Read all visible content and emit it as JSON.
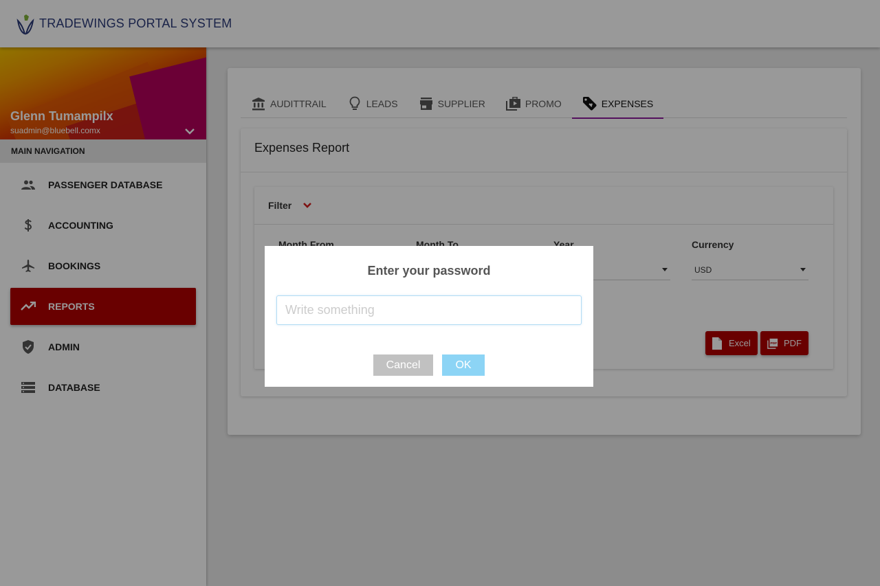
{
  "app": {
    "title": "TRADEWINGS PORTAL SYSTEM"
  },
  "profile": {
    "name": "Glenn Tumampilx",
    "email": "suadmin@bluebell.comx"
  },
  "sidebar": {
    "header": "MAIN NAVIGATION",
    "items": [
      {
        "label": "PASSENGER DATABASE",
        "icon": "people-icon",
        "active": false
      },
      {
        "label": "ACCOUNTING",
        "icon": "dollar-icon",
        "active": false
      },
      {
        "label": "BOOKINGS",
        "icon": "airplane-icon",
        "active": false
      },
      {
        "label": "REPORTS",
        "icon": "trending-up-icon",
        "active": true
      },
      {
        "label": "ADMIN",
        "icon": "shield-check-icon",
        "active": false
      },
      {
        "label": "DATABASE",
        "icon": "storage-icon",
        "active": false
      }
    ]
  },
  "tabs": [
    {
      "label": "AUDITTRAIL",
      "icon": "bank-icon",
      "active": false
    },
    {
      "label": "LEADS",
      "icon": "lightbulb-icon",
      "active": false
    },
    {
      "label": "SUPPLIER",
      "icon": "store-icon",
      "active": false
    },
    {
      "label": "PROMO",
      "icon": "video-library-icon",
      "active": false
    },
    {
      "label": "EXPENSES",
      "icon": "tag-heart-icon",
      "active": true
    }
  ],
  "report": {
    "title": "Expenses Report",
    "filter_label": "Filter",
    "fields": [
      {
        "label": "Month From",
        "value": ""
      },
      {
        "label": "Month To",
        "value": ""
      },
      {
        "label": "Year",
        "value": ""
      },
      {
        "label": "Currency",
        "value": "USD"
      }
    ],
    "excel_label": "Excel",
    "pdf_label": "PDF"
  },
  "dialog": {
    "title": "Enter your password",
    "input_placeholder": "Write something",
    "input_value": "",
    "cancel_label": "Cancel",
    "ok_label": "OK"
  },
  "colors": {
    "brand_red": "#b00000",
    "tab_underline": "#8a1c9c",
    "ok_button": "#8cd4f5",
    "cancel_button": "#c1c1c1",
    "title_blue": "#2b3a78"
  }
}
